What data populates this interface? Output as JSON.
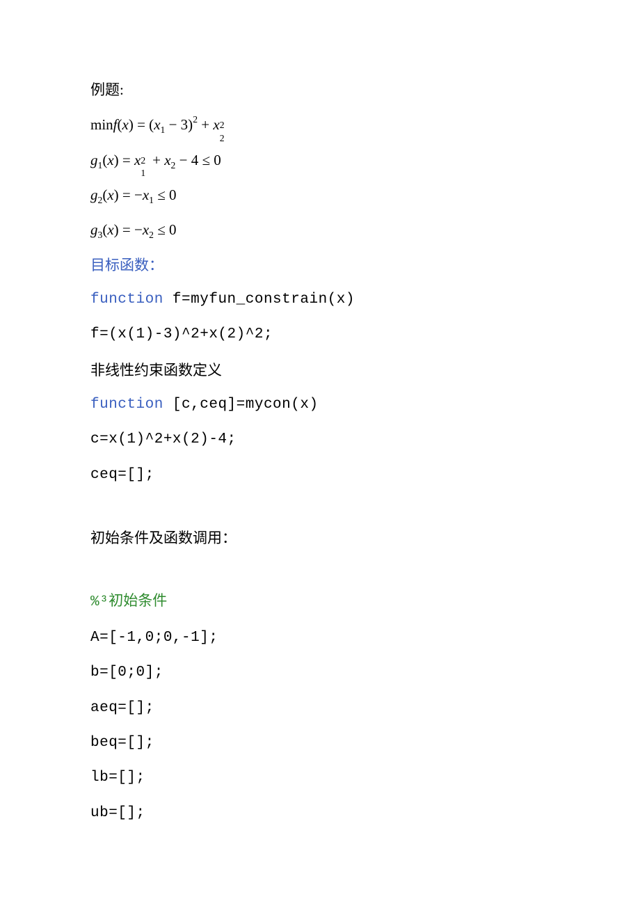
{
  "title": "例题:",
  "equations": {
    "minf_prefix": "min",
    "minf_f": "f",
    "minf_open": "(",
    "minf_x": "x",
    "minf_close": ") = (",
    "minf_x1": "x",
    "minf_sub1": "1",
    "minf_minus3": " − 3)",
    "minf_sq": "2",
    "minf_plus": " + ",
    "minf_x2": "x",
    "minf_22sub": "2",
    "minf_22sup": "2",
    "g1_g": "g",
    "g1_sub": "1",
    "g1_open": "(",
    "g1_x": "x",
    "g1_close": ") = ",
    "g1_x1": "x",
    "g1_1sub": "1",
    "g1_1sup": "2",
    "g1_plus": " + ",
    "g1_x2": "x",
    "g1_2sub": "2",
    "g1_tail": " − 4 ≤ 0",
    "g2_g": "g",
    "g2_sub": "2",
    "g2_open": "(",
    "g2_x": "x",
    "g2_close": ") = −",
    "g2_x1": "x",
    "g2_1sub": "1",
    "g2_tail": " ≤ 0",
    "g3_g": "g",
    "g3_sub": "3",
    "g3_open": "(",
    "g3_x": "x",
    "g3_close": ") = −",
    "g3_x2": "x",
    "g3_2sub": "2",
    "g3_tail": " ≤ 0"
  },
  "labels": {
    "objective": "目标函数：",
    "nl_constraint_def": "非线性约束函数定义",
    "initial_and_call": "初始条件及函数调用：",
    "pct3": "%³",
    "initial_cond": "初始条件"
  },
  "code": {
    "fn1_kw": "function",
    "fn1_rest": " f=myfun_constrain(x)",
    "fline": "f=(x(1)-3)^2+x(2)^2;",
    "fn2_kw": "function",
    "fn2_rest": " [c,ceq]=mycon(x)",
    "cline": "c=x(1)^2+x(2)-4;",
    "ceqline": "ceq=[];",
    "A": "A=[-1,0;0,-1];",
    "b": "b=[0;0];",
    "aeq": "aeq=[];",
    "beq": "beq=[];",
    "lb": "lb=[];",
    "ub": "ub=[];"
  }
}
